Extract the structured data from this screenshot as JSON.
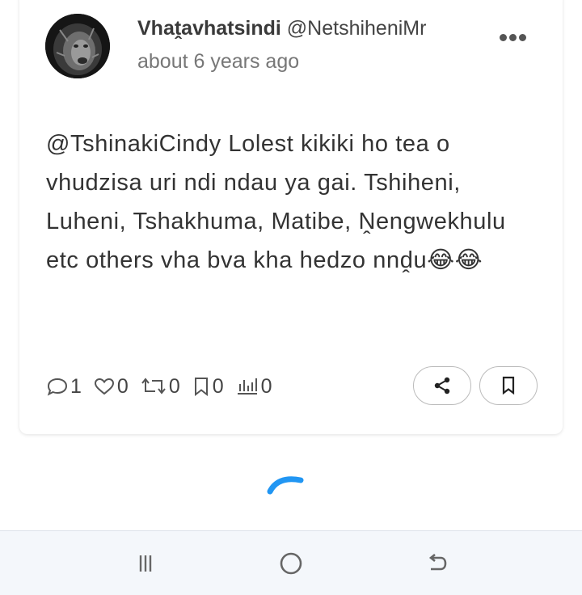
{
  "post": {
    "display_name": "Vhaṱavhatsindi",
    "handle": "@NetshiheniMr",
    "timestamp": "about 6 years ago",
    "text": "@TshinakiCindy Lolest kikiki ho tea o vhudzisa uri ndi ndau ya gai. Tshiheni, Luheni, Tshakhuma, Matibe, Ṋengwekhulu etc others vha bva kha hedzo nnḓu😂😂",
    "stats": {
      "replies": "1",
      "likes": "0",
      "reposts": "0",
      "bookmarks": "0",
      "views": "0"
    }
  },
  "icons": {
    "more": "more-horizontal-icon",
    "reply": "speech-bubble-icon",
    "like": "heart-icon",
    "repost": "repost-arrows-icon",
    "bookmark": "bookmark-icon",
    "views": "bar-chart-icon",
    "share": "share-icon",
    "loading": "loading-spinner-icon"
  },
  "colors": {
    "spinner": "#2196f3",
    "nav_background": "#f4f7fb",
    "secondary_text": "#777777"
  }
}
